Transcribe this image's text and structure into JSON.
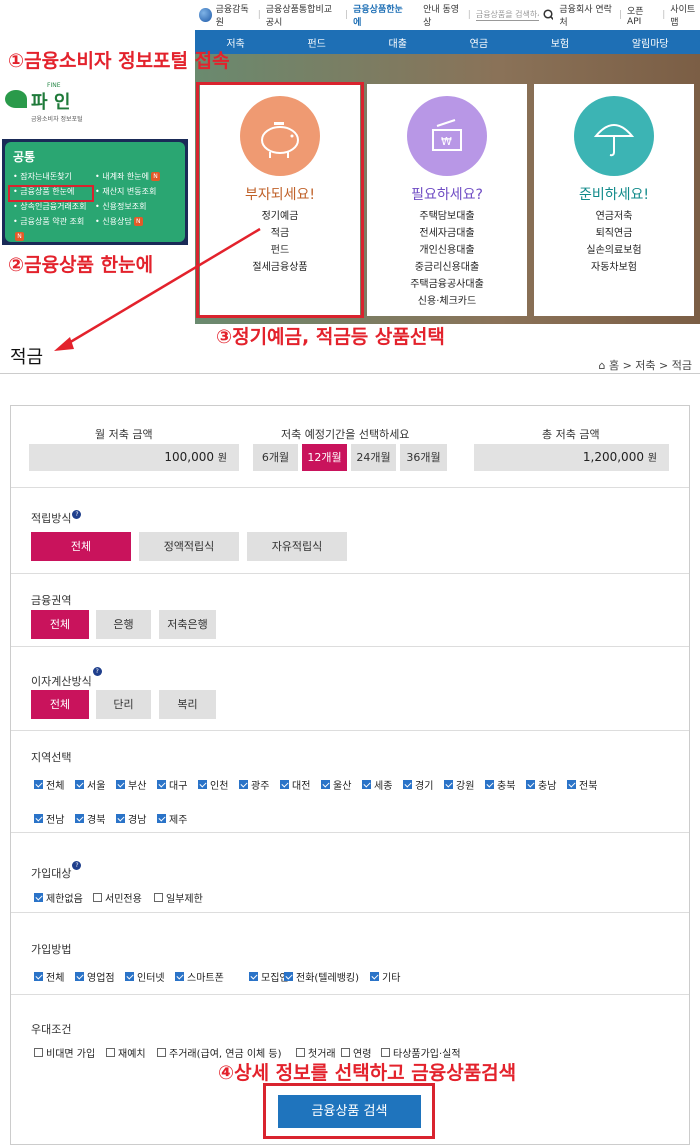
{
  "topbar": {
    "org": "금융감독원",
    "compare": "금융상품통합비교공시",
    "glance": "금융상품한눈에",
    "guide_video": "안내 동영상",
    "search_placeholder": "금융상품을 검색하세요",
    "contacts": "금융회사 연락처",
    "open_api": "오픈 API",
    "sitemap": "사이트맵"
  },
  "gnb": [
    "저축",
    "펀드",
    "대출",
    "연금",
    "보험",
    "알림마당"
  ],
  "cards": [
    {
      "title": "부자되세요!",
      "color": "#ef9a72",
      "title_color": "#c0622a",
      "items": [
        "정기예금",
        "적금",
        "펀드",
        "절세금융상품"
      ]
    },
    {
      "title": "필요하세요?",
      "color": "#b897e6",
      "title_color": "#6f4cc4",
      "items": [
        "주택담보대출",
        "전세자금대출",
        "개인신용대출",
        "중금리신용대출",
        "주택금융공사대출",
        "신용·체크카드"
      ]
    },
    {
      "title": "준비하세요!",
      "color": "#3cb4b4",
      "title_color": "#118a8a",
      "items": [
        "연금저축",
        "퇴직연금",
        "실손의료보험",
        "자동차보험"
      ]
    }
  ],
  "logo": {
    "brand": "파 인",
    "fine": "FINE",
    "sub": "금융소비자 정보포털"
  },
  "sidebar": {
    "head": "공통",
    "items": [
      "잠자는내돈찾기",
      "내계좌 한눈에",
      "금융상품 한눈에",
      "재산지 변동조회",
      "상속인금융거래조회",
      "신용정보조회",
      "금융상품 약관 조회",
      "신용상담"
    ]
  },
  "annotations": {
    "a1": "①금융소비자 정보포털 접속",
    "a2": "②금융상품 한눈에",
    "a3": "③정기예금, 적금등 상품선택",
    "a4": "④상세 정보를 선택하고 금융상품검색"
  },
  "page": {
    "title": "적금",
    "breadcrumb": "홈 > 저축 > 적금"
  },
  "savings": {
    "monthly_label": "월 저축 금액",
    "monthly_value": "100,000",
    "period_label": "저축 예정기간을 선택하세요",
    "periods": [
      "6개월",
      "12개월",
      "24개월",
      "36개월"
    ],
    "total_label": "총 저축 금액",
    "total_value": "1,200,000",
    "unit": "원"
  },
  "method": {
    "label": "적립방식",
    "options": [
      "전체",
      "정액적립식",
      "자유적립식"
    ]
  },
  "region": {
    "label": "금융권역",
    "options": [
      "전체",
      "은행",
      "저축은행"
    ]
  },
  "interest": {
    "label": "이자계산방식",
    "options": [
      "전체",
      "단리",
      "복리"
    ]
  },
  "area": {
    "label": "지역선택",
    "options": [
      "전체",
      "서울",
      "부산",
      "대구",
      "인천",
      "광주",
      "대전",
      "울산",
      "세종",
      "경기",
      "강원",
      "충북",
      "충남",
      "전북",
      "전남",
      "경북",
      "경남",
      "제주"
    ]
  },
  "target": {
    "label": "가입대상",
    "options": [
      "제한없음",
      "서민전용",
      "일부제한"
    ]
  },
  "channel": {
    "label": "가입방법",
    "options": [
      "전체",
      "영업점",
      "인터넷",
      "스마트폰",
      "모집인",
      "전화(텔레뱅킹)",
      "기타"
    ]
  },
  "preference": {
    "label": "우대조건",
    "options": [
      "비대면 가입",
      "재예치",
      "주거래(급여, 연금 이체 등)",
      "첫거래",
      "연령",
      "타상품가입·실적"
    ]
  },
  "search_button": "금융상품 검색"
}
